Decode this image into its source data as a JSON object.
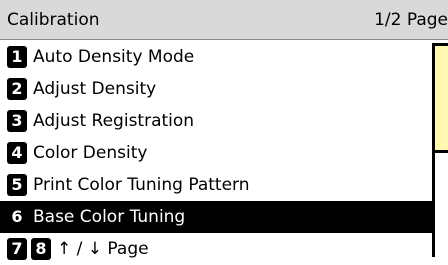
{
  "header": {
    "title": "Calibration",
    "page": "1/2 Page"
  },
  "menu": {
    "items": [
      {
        "num": "1",
        "label": "Auto Density Mode",
        "selected": false
      },
      {
        "num": "2",
        "label": "Adjust Density",
        "selected": false
      },
      {
        "num": "3",
        "label": "Adjust Registration",
        "selected": false
      },
      {
        "num": "4",
        "label": "Color Density",
        "selected": false
      },
      {
        "num": "5",
        "label": "Print Color Tuning Pattern",
        "selected": false
      },
      {
        "num": "6",
        "label": "Base Color Tuning",
        "selected": true
      }
    ],
    "paging": {
      "num_prev": "7",
      "num_next": "8",
      "label": "↑ / ↓ Page"
    }
  },
  "colors": {
    "header_bg": "#d9d9d9",
    "selected_bg": "#000000",
    "side_panel": "#fff9b0"
  }
}
